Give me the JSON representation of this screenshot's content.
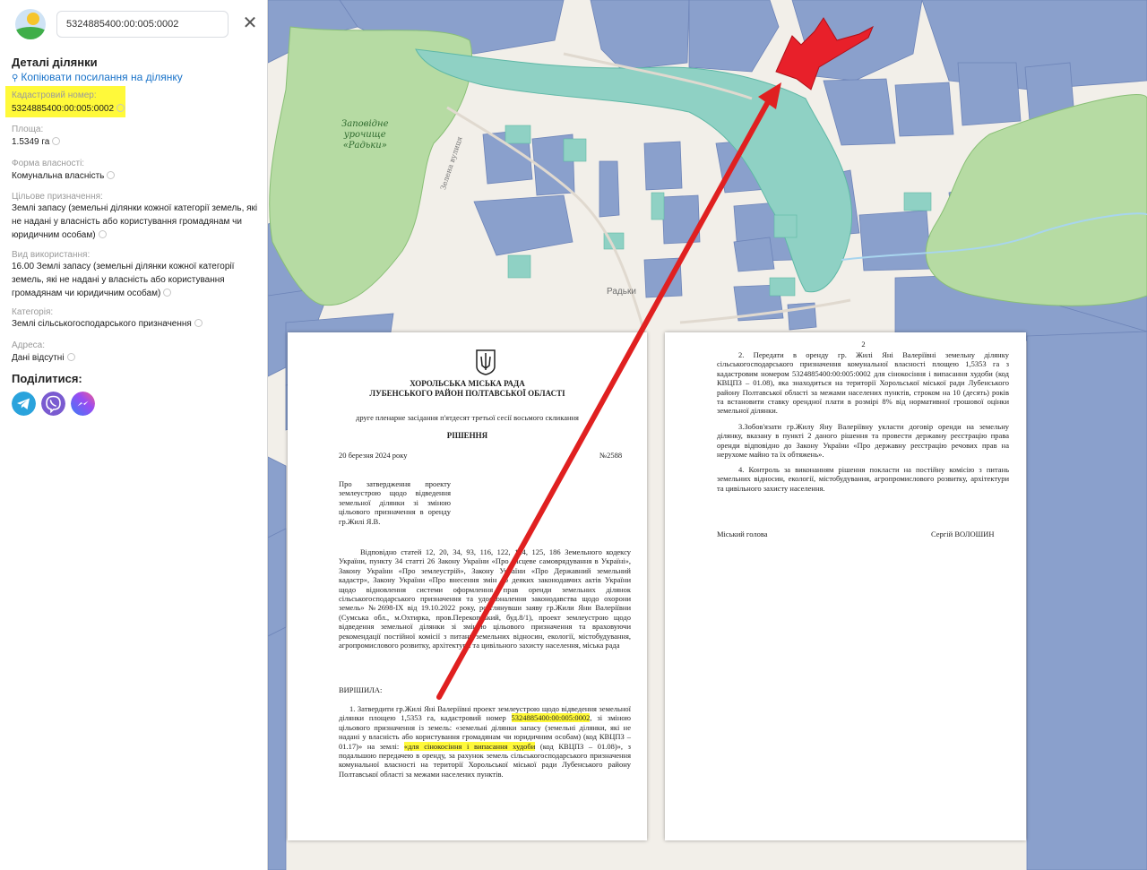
{
  "search": {
    "value": "5324885400:00:005:0002"
  },
  "details": {
    "title": "Деталі ділянки",
    "copy_link": "Копіювати посилання на ділянку",
    "cadastral": {
      "label": "Кадастровий номер:",
      "value": "5324885400:00:005:0002"
    },
    "area": {
      "label": "Площа:",
      "value": "1.5349 га"
    },
    "ownership": {
      "label": "Форма власності:",
      "value": "Комунальна власність"
    },
    "purpose": {
      "label": "Цільове призначення:",
      "value": "Землі запасу (земельні ділянки кожної категорії земель, які не надані у власність або користування громадянам чи юридичним особам)"
    },
    "usage": {
      "label": "Вид використання:",
      "value": "16.00 Землі запасу (земельні ділянки кожної категорії земель, які не надані у власність або користування громадянам чи юридичним особам)"
    },
    "category": {
      "label": "Категорія:",
      "value": "Землі сільськогосподарського призначення"
    },
    "address": {
      "label": "Адреса:",
      "value": "Дані відсутні"
    }
  },
  "share": {
    "title": "Поділитися:",
    "buttons": [
      {
        "icon": "telegram-icon",
        "color": "#2aa3dc"
      },
      {
        "icon": "viber-icon",
        "color": "#7a5bd0"
      },
      {
        "icon": "messenger-icon",
        "color": "#7b4bf0"
      }
    ]
  },
  "map": {
    "labels": {
      "tract": "Заповідне\nурочище\n«Радьки»",
      "village": "Радьки",
      "road": "Зелена вулиця"
    },
    "colors": {
      "parcel": "#8aa0cc",
      "forest": "#b6dba3",
      "water": "#8fd1c4",
      "selected": "#e8202a",
      "arrow": "#e02020"
    }
  },
  "document_page1": {
    "council_line1": "ХОРОЛЬСЬКА МІСЬКА РАДА",
    "council_line2": "ЛУБЕНСЬКОГО РАЙОН ПОЛТАВСЬКОЇ ОБЛАСТІ",
    "session": "друге пленарне засідання п'ятдесят третьої сесії восьмого скликання",
    "decision": "РІШЕННЯ",
    "date": "20 березня 2024 року",
    "number": "№2588",
    "subject": "Про затвердження проекту землеустрою щодо відведення земельної ділянки зі зміною цільового призначення в оренду гр.Жилі Я.В.",
    "body": "Відповідно статей 12, 20, 34, 93, 116, 122, 124, 125, 186 Земельного кодексу України, пункту 34 статті 26 Закону України «Про місцеве самоврядування в Україні», Закону України «Про землеустрій», Закону України «Про Державний земельний кадастр», Закону України «Про внесення змін до деяких законодавчих актів України щодо відновлення системи оформлення прав оренди земельних ділянок сільськогосподарського призначення та удосконалення законодавства щодо охорони земель» №2698-IX від 19.10.2022 року, розглянувши заяву гр.Жили Яни Валеріївни (Сумська обл., м.Охтирка, пров.Перекопський, буд.8/1), проект землеустрою щодо відведення земельної ділянки зі зміною цільового призначення та враховуючи рекомендації постійної комісії з питань земельних відносин, екології, містобудування, агропромислового розвитку, архітектури та цивільного захисту населення, міська рада",
    "resolved": "ВИРІШИЛА:",
    "item1_a": "1. Затвердити гр.Жилі Яні Валеріївні проект землеустрою щодо відведення земельної ділянки площею 1,5353 га, кадастровий номер",
    "item1_cad": "5324885400:00:005:0002",
    "item1_b": ", зі зміною цільового призначення із земель: «земельні ділянки запасу (земельні ділянки, які не надані у власність або користування громадянам чи юридичним особам) (код КВЦПЗ – 01.17)» на землі:",
    "item1_use": "«для сінокосіння і випасання худоби",
    "item1_c": "(код КВЦПЗ – 01.08)», з подальшою передачею в оренду, за рахунок земель сільськогосподарського призначення комунальної власності на території Хорольської міської ради Лубенського району Полтавської області за межами населених пунктів."
  },
  "document_page2": {
    "page_number": "2",
    "item2": "2. Передати в оренду гр. Жилі Яні Валеріївні земельну ділянку сільськогосподарського призначення комунальної власності площею 1,5353 га з кадастровим номером 5324885400:00:005:0002 для сінокосіння і випасання худоби (код КВЦПЗ – 01.08), яка знаходиться на території Хорольської міської ради Лубенського району Полтавської області за межами населених пунктів, строком на 10 (десять) років та встановити ставку орендної плати в розмірі 8% від нормативної грошової оцінки земельної ділянки.",
    "item3": "3.Зобов'язати гр.Жилу Яну Валеріївну укласти договір оренди на земельну ділянку, вказану в пункті 2 даного рішення та провести державну реєстрацію права оренди відповідно до Закону України «Про державну реєстрацію речових прав на нерухоме майно та їх обтяжень».",
    "item4": "4. Контроль за виконанням рішення покласти на постійну комісію з питань земельних відносин, екології, містобудування, агропромислового розвитку, архітектури та цивільного захисту населення.",
    "signer_title": "Міський голова",
    "signer_name": "Сергій ВОЛОШИН"
  }
}
